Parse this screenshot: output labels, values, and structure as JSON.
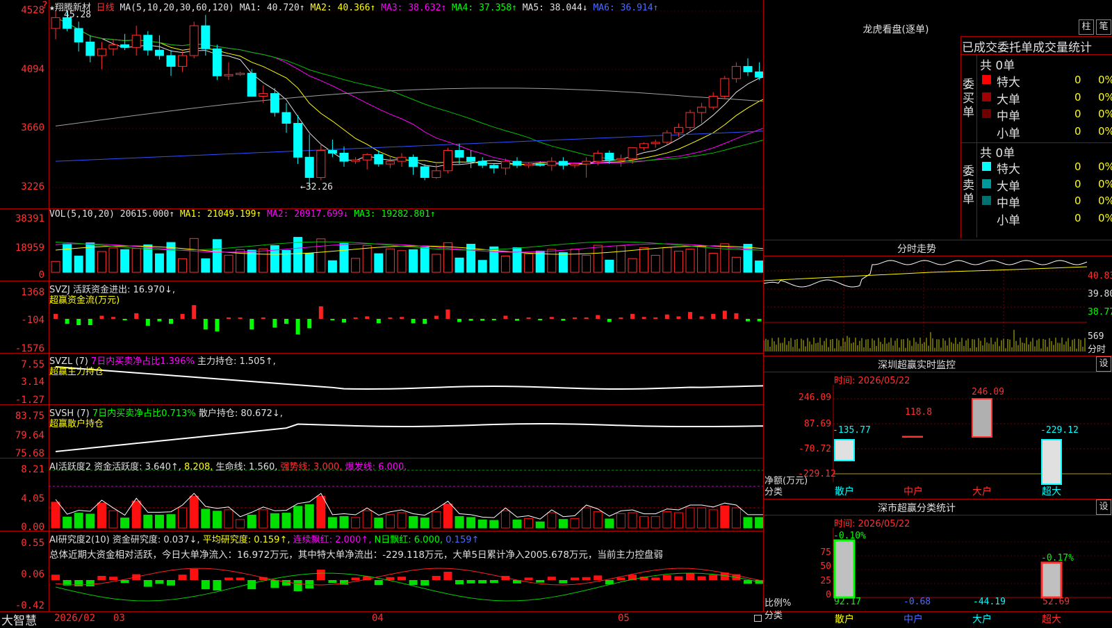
{
  "stock": {
    "name": "★翔腾新材",
    "period": "日线",
    "ma_label": "MA(5,10,20,30,60,120)",
    "ma1": "MA1: 40.720↑",
    "ma2": "MA2: 40.366↑",
    "ma3": "MA3: 38.632↑",
    "ma4": "MA4: 37.358↑",
    "ma5": "MA5: 38.044↓",
    "ma6": "MA6: 36.914↑",
    "high_note": "45.28",
    "low_note": "←32.26",
    "price_ticks": [
      "4528",
      "4094",
      "3660",
      "3226"
    ],
    "corner": "?"
  },
  "vol": {
    "label": "VOL(5,10,20)",
    "val": "20615.000↑",
    "ma1": "MA1: 21049.199↑",
    "ma2": "MA2: 20917.699↓",
    "ma3": "MA3: 19282.801↑",
    "ticks": [
      "38391",
      "18959",
      "0"
    ]
  },
  "svzj": {
    "label": "SVZJ  活跃资金进出: 16.970↓,",
    "sub": "超赢资金流(万元)",
    "ticks": [
      "1368",
      "-104",
      "-1576"
    ]
  },
  "svzl": {
    "label": "SVZL (7)",
    "p1": "7日内买卖净占比1.396%",
    "p2": "主力持仓: 1.505↑,",
    "sub": "超赢主力持仓",
    "ticks": [
      "7.55",
      "3.14",
      "-1.27"
    ]
  },
  "svsh": {
    "label": "SVSH (7)",
    "p1": "7日内买卖净占比0.713%",
    "p2": "散户持仓: 80.672↓,",
    "sub": "超赢散户持仓",
    "ticks": [
      "83.75",
      "79.64",
      "75.68"
    ]
  },
  "ai1": {
    "label": "AI活跃度2 资金活跃度: 3.640↑,",
    "v2": "8.208,",
    "v3": "生命线: 1.560,",
    "v4": "强势线: 3.000,",
    "v5": "爆发线: 6.000,",
    "ticks": [
      "8.21",
      "4.05",
      "0.00"
    ]
  },
  "ai2": {
    "label": "AI研究度2(10) 资金研究度: 0.037↓,",
    "v2": "平均研究度: 0.159↑,",
    "v3": "连续飘红: 2.000↑,",
    "v4": "N日飘红: 6.000,",
    "v5": "0.159↑",
    "summary": "总体近期大资金相对活跃，今日大单净流入：16.972万元，其中特大单净流出：-229.118万元，大单5日累计净入2005.678万元，当前主力控盘弱",
    "ticks": [
      "0.55",
      "0.06",
      "-0.42"
    ]
  },
  "footer": {
    "brand": "大智慧",
    "dates": [
      "2026/02",
      "03",
      "04",
      "05"
    ]
  },
  "lhb": {
    "title": "龙虎看盘(逐单)",
    "btn1": "柱",
    "btn2": "笔",
    "tabs": "已成交委托单成交量统计",
    "buy_side": "委买单",
    "sell_side": "委卖单",
    "buy_total": "共 0单",
    "sell_total": "共 0单",
    "buy_rows": [
      {
        "name": "特大",
        "val": "0",
        "pct": "0%",
        "color": "#ff0000"
      },
      {
        "name": "大单",
        "val": "0",
        "pct": "0%",
        "color": "#a00000"
      },
      {
        "name": "中单",
        "val": "0",
        "pct": "0%",
        "color": "#700000"
      },
      {
        "name": "小单",
        "val": "0",
        "pct": "0%",
        "color": ""
      }
    ],
    "sell_rows": [
      {
        "name": "特大",
        "val": "0",
        "pct": "0%",
        "color": "#00ffff"
      },
      {
        "name": "大单",
        "val": "0",
        "pct": "0%",
        "color": "#009898"
      },
      {
        "name": "中单",
        "val": "0",
        "pct": "0%",
        "color": "#007070"
      },
      {
        "name": "小单",
        "val": "0",
        "pct": "0%",
        "color": ""
      }
    ]
  },
  "fenshi": {
    "title": "分时走势",
    "ticks": [
      "40.83",
      "39.80",
      "38.77"
    ],
    "vol_tick": "569",
    "vol_label": "分时"
  },
  "monitor": {
    "title": "深圳超赢实时监控",
    "set": "设",
    "time": "时间: 2026/05/22",
    "ticks": [
      "246.09",
      "87.69",
      "-70.72",
      "-229.12"
    ],
    "ylabel": "净额(万元)",
    "xlabel": "分类",
    "cats": [
      "散户",
      "中户",
      "大户",
      "超大"
    ],
    "values": [
      "-135.77",
      "118.8",
      "246.09",
      "-229.12"
    ]
  },
  "classify": {
    "title": "深市超赢分类统计",
    "set": "设",
    "time": "时间: 2026/05/22",
    "ticks": [
      "75",
      "50",
      "25",
      "0"
    ],
    "ylabel": "比例%",
    "xlabel": "分类",
    "cats": [
      "散户",
      "中户",
      "大户",
      "超大"
    ],
    "bottom_vals": [
      "92.17",
      "-0.68",
      "-44.19",
      "52.69"
    ],
    "top_vals": [
      "-0.10%",
      "",
      "",
      "-0.17%"
    ]
  },
  "chart_data": [
    {
      "type": "candlestick",
      "title": "翔腾新材 日线",
      "ylim": [
        3226,
        4528
      ],
      "ohlc": [
        [
          44.0,
          45.28,
          43.2,
          44.8
        ],
        [
          44.8,
          45.2,
          43.8,
          44.0
        ],
        [
          44.0,
          44.5,
          42.3,
          43.0
        ],
        [
          43.0,
          43.5,
          41.5,
          42.0
        ],
        [
          42.0,
          43.0,
          41.0,
          42.5
        ],
        [
          42.5,
          43.2,
          42.0,
          42.8
        ],
        [
          42.8,
          43.6,
          42.4,
          42.6
        ],
        [
          42.6,
          44.2,
          42.0,
          43.5
        ],
        [
          43.5,
          43.8,
          42.0,
          42.4
        ],
        [
          42.4,
          43.5,
          41.7,
          42.0
        ],
        [
          42.0,
          42.4,
          40.5,
          41.2
        ],
        [
          41.2,
          42.3,
          40.8,
          42.0
        ],
        [
          42.0,
          44.5,
          41.8,
          44.2
        ],
        [
          44.2,
          45.0,
          42.0,
          42.5
        ],
        [
          42.5,
          42.8,
          40.2,
          40.5
        ],
        [
          40.5,
          41.5,
          40.2,
          40.6
        ],
        [
          40.6,
          40.8,
          40.5,
          40.7
        ],
        [
          40.7,
          41.0,
          39.2,
          39.0
        ],
        [
          39.0,
          39.8,
          38.5,
          39.2
        ],
        [
          39.2,
          39.6,
          37.5,
          37.8
        ],
        [
          37.8,
          38.5,
          36.3,
          37.0
        ],
        [
          37.0,
          37.6,
          34.0,
          34.5
        ],
        [
          34.5,
          36.2,
          32.26,
          33.0
        ],
        [
          33.0,
          35.5,
          32.8,
          35.0
        ],
        [
          35.0,
          35.8,
          34.5,
          34.8
        ],
        [
          34.8,
          35.3,
          33.8,
          34.2
        ],
        [
          34.2,
          34.5,
          34.0,
          34.3
        ],
        [
          34.3,
          34.8,
          33.6,
          34.7
        ],
        [
          34.7,
          35.0,
          33.8,
          34.0
        ],
        [
          34.0,
          34.5,
          33.7,
          34.2
        ],
        [
          34.2,
          34.8,
          33.8,
          34.5
        ],
        [
          34.5,
          34.7,
          33.2,
          33.8
        ],
        [
          33.8,
          34.0,
          32.8,
          33.0
        ],
        [
          33.0,
          34.0,
          32.9,
          33.5
        ],
        [
          33.5,
          35.2,
          33.3,
          35.0
        ],
        [
          35.0,
          35.5,
          34.0,
          34.5
        ],
        [
          34.5,
          35.0,
          33.7,
          34.2
        ],
        [
          34.2,
          34.5,
          33.7,
          33.9
        ],
        [
          33.9,
          34.0,
          33.3,
          33.7
        ],
        [
          33.7,
          34.4,
          33.2,
          34.2
        ],
        [
          34.2,
          34.5,
          33.7,
          33.9
        ],
        [
          33.9,
          34.1,
          33.7,
          34.0
        ],
        [
          34.0,
          34.2,
          33.8,
          33.9
        ],
        [
          33.9,
          34.5,
          33.5,
          34.2
        ],
        [
          34.2,
          34.5,
          33.6,
          33.9
        ],
        [
          33.9,
          34.1,
          33.7,
          34.0
        ],
        [
          34.0,
          34.5,
          33.0,
          34.2
        ],
        [
          34.2,
          35.0,
          33.9,
          34.8
        ],
        [
          34.8,
          35.0,
          34.0,
          34.3
        ],
        [
          34.3,
          34.7,
          33.8,
          34.4
        ],
        [
          34.4,
          35.0,
          34.0,
          35.2
        ],
        [
          35.2,
          35.6,
          35.0,
          35.5
        ],
        [
          35.5,
          35.8,
          35.2,
          35.6
        ],
        [
          35.6,
          36.5,
          35.4,
          36.3
        ],
        [
          36.3,
          37.0,
          36.0,
          36.7
        ],
        [
          36.7,
          38.0,
          36.5,
          37.8
        ],
        [
          37.8,
          38.5,
          37.0,
          38.2
        ],
        [
          38.2,
          39.3,
          38.0,
          39.0
        ],
        [
          39.0,
          40.5,
          38.8,
          40.3
        ],
        [
          40.3,
          41.5,
          40.0,
          41.2
        ],
        [
          41.2,
          41.8,
          40.5,
          40.8
        ],
        [
          40.8,
          41.5,
          40.2,
          40.4
        ],
        [
          40.4,
          40.8,
          39.5,
          39.8
        ],
        [
          39.8,
          40.5,
          38.6,
          38.9
        ],
        [
          38.9,
          39.5,
          38.6,
          39.3
        ],
        [
          39.3,
          40.2,
          38.7,
          39.0
        ],
        [
          39.0,
          41.5,
          38.8,
          41.3
        ],
        [
          41.3,
          42.8,
          39.6,
          41.0
        ],
        [
          41.0,
          42.5,
          38.0,
          39.5
        ],
        [
          39.5,
          41.5,
          39.3,
          41.8
        ]
      ]
    },
    {
      "type": "bar",
      "title": "VOL(5,10,20)",
      "ylim": [
        0,
        38391
      ]
    },
    {
      "type": "bar",
      "title": "超赢资金流(万元)",
      "ylim": [
        -1576,
        1368
      ]
    },
    {
      "type": "line",
      "title": "超赢主力持仓",
      "ylim": [
        -1.27,
        7.55
      ]
    },
    {
      "type": "line",
      "title": "超赢散户持仓",
      "ylim": [
        75.68,
        83.75
      ]
    },
    {
      "type": "bar",
      "title": "AI活跃度2",
      "ylim": [
        0,
        8.21
      ]
    },
    {
      "type": "bar",
      "title": "AI研究度2(10)",
      "ylim": [
        -0.42,
        0.55
      ]
    },
    {
      "type": "bar",
      "title": "深圳超赢实时监控",
      "categories": [
        "散户",
        "中户",
        "大户",
        "超大"
      ],
      "values": [
        -135.77,
        118.8,
        246.09,
        -229.12
      ],
      "ylim": [
        -229.12,
        246.09
      ]
    },
    {
      "type": "bar",
      "title": "深市超赢分类统计",
      "categories": [
        "散户",
        "中户",
        "大户",
        "超大"
      ],
      "values": [
        92.17,
        -0.68,
        -44.19,
        52.69
      ]
    }
  ]
}
